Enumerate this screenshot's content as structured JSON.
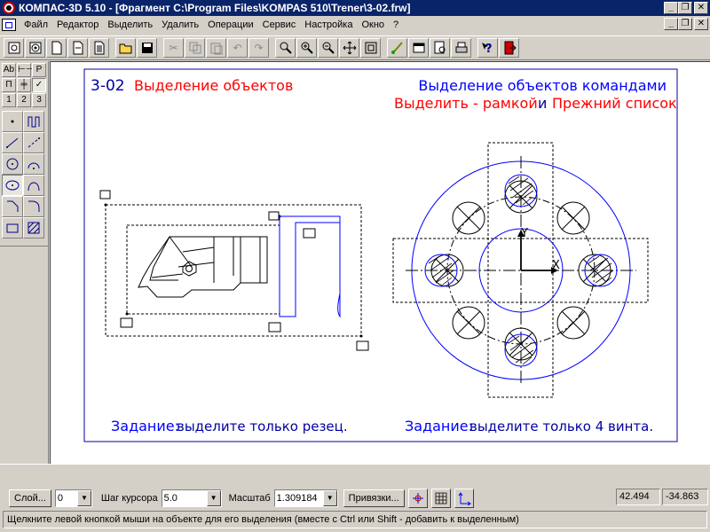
{
  "window": {
    "title": "КОМПАС-3D 5.10 - [Фрагмент C:\\Program Files\\KOMPAS 510\\Trener\\3-02.frw]",
    "minimize": "_",
    "restore": "❐",
    "close": "✕"
  },
  "menu": {
    "items": [
      {
        "label": "Файл"
      },
      {
        "label": "Редактор"
      },
      {
        "label": "Выделить"
      },
      {
        "label": "Удалить"
      },
      {
        "label": "Операции"
      },
      {
        "label": "Сервис"
      },
      {
        "label": "Настройка"
      },
      {
        "label": "Окно"
      },
      {
        "label": "?"
      }
    ]
  },
  "toolbar": {
    "icons": [
      "new-doc-icon",
      "new-fragment-icon",
      "new-sheet-icon",
      "new-spec-icon",
      "new-text-icon",
      "open-folder-icon",
      "save-icon",
      "cut-icon",
      "copy-icon",
      "paste-icon",
      "undo-icon",
      "redo-icon",
      "zoom-window-icon",
      "zoom-in-icon",
      "zoom-out-icon",
      "pan-icon",
      "show-all-icon",
      "brush-icon",
      "properties-icon",
      "preview-icon",
      "print-icon",
      "help-icon",
      "exit-icon"
    ]
  },
  "left_panel": {
    "grid": [
      "Аb",
      "⊢⊣",
      "P",
      "П",
      "╪",
      "✓",
      "1",
      "2",
      "3"
    ],
    "tools": [
      "point-icon",
      "spline-icon",
      "segment-icon",
      "dashed-line-icon",
      "circle-icon",
      "arc-icon",
      "ellipse-icon",
      "bezier-icon",
      "chamfer-icon",
      "fillet-icon",
      "rectangle-icon",
      "hatch-icon"
    ]
  },
  "drawing": {
    "heading_number": "3-02",
    "heading_title": "Выделение объектов",
    "right_line1": "Выделение объектов командами",
    "right_line2_a": "Выделить - рамкой",
    "right_line2_b": "и",
    "right_line2_c": "Прежний список",
    "task_label_left": "Задание:",
    "task_text_left": "выделите только резец.",
    "task_label_right": "Задание:",
    "task_text_right": "выделите только 4 винта.",
    "axis_y": "Y",
    "axis_x": "X"
  },
  "props": {
    "layer_btn": "Слой...",
    "layer_value": "0",
    "step_label": "Шаг курсора",
    "step_value": "5.0",
    "scale_label": "Масштаб",
    "scale_value": "1.309184",
    "snap_btn": "Привязки...",
    "coord_x": "42.494",
    "coord_y": "-34.863"
  },
  "hint": "Щелкните левой кнопкой мыши на объекте для его выделения (вместе с Ctrl или Shift - добавить к выделенным)",
  "colors": {
    "blue": "#0000ff",
    "red": "#ff0000",
    "navy": "#0000a0",
    "title_bar": "#0a246a"
  }
}
